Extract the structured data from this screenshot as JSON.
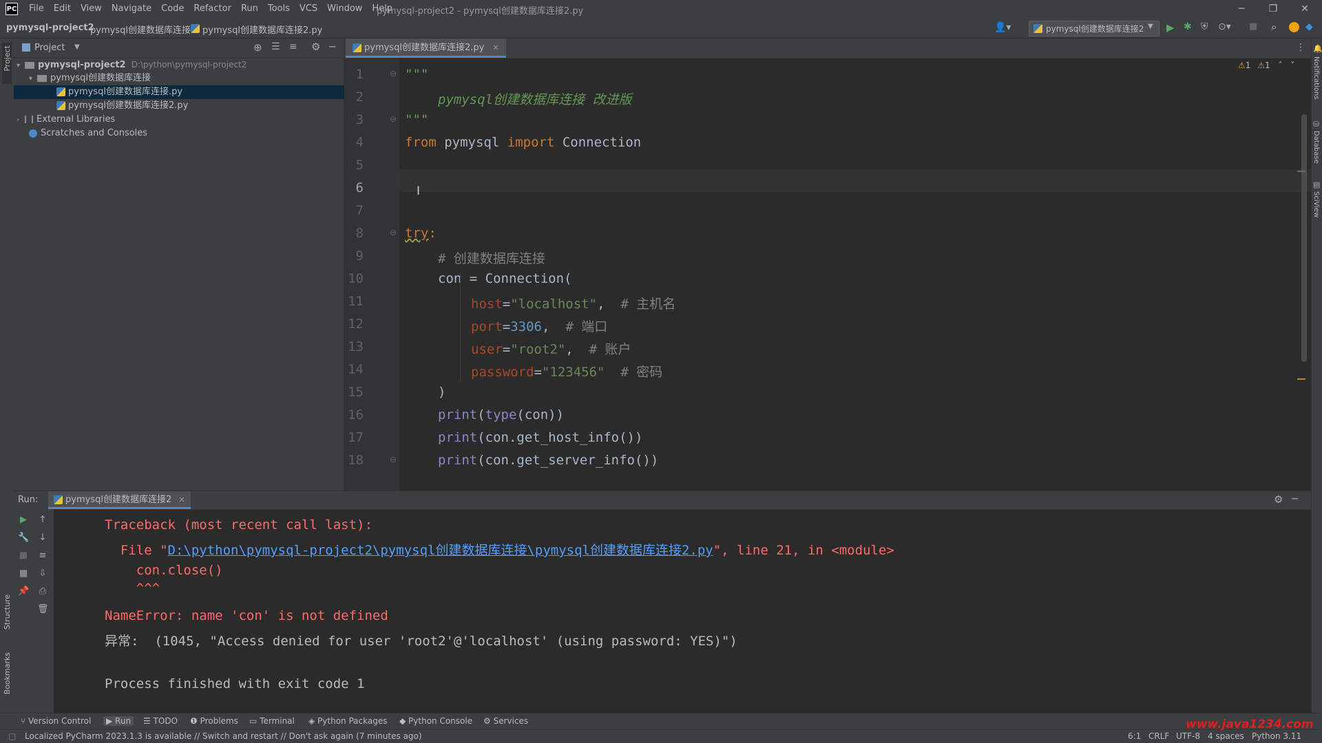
{
  "window": {
    "logo": "PC",
    "title": "pymysql-project2 - pymysql创建数据库连接2.py",
    "menu": [
      "File",
      "Edit",
      "View",
      "Navigate",
      "Code",
      "Refactor",
      "Run",
      "Tools",
      "VCS",
      "Window",
      "Help"
    ]
  },
  "breadcrumb": {
    "project": "pymysql-project2",
    "folder": "pymysql创建数据库连接",
    "file": "pymysql创建数据库连接2.py"
  },
  "toolbar": {
    "run_config": "pymysql创建数据库连接2"
  },
  "left_strip": {
    "project": "Project",
    "structure": "Structure",
    "bookmarks": "Bookmarks"
  },
  "right_strip": {
    "notifications": "Notifications",
    "database": "Database",
    "sciview": "SciView"
  },
  "project_panel": {
    "title": "Project",
    "tree": {
      "root_name": "pymysql-project2",
      "root_path": "D:\\python\\pymysql-project2",
      "folder": "pymysql创建数据库连接",
      "file1": "pymysql创建数据库连接.py",
      "file2": "pymysql创建数据库连接2.py",
      "external": "External Libraries",
      "scratches": "Scratches and Consoles"
    }
  },
  "editor": {
    "tab_label": "pymysql创建数据库连接2.py",
    "inspection": {
      "warnings": "1",
      "weak_warnings": "1"
    },
    "line_numbers": [
      "1",
      "2",
      "3",
      "4",
      "5",
      "6",
      "7",
      "8",
      "9",
      "10",
      "11",
      "12",
      "13",
      "14",
      "15",
      "16",
      "17",
      "18"
    ],
    "current_line": "6",
    "code": {
      "l1": "\"\"\"",
      "l2": "pymysql创建数据库连接 改进版",
      "l3": "\"\"\"",
      "l4_from": "from",
      "l4_mod": "pymysql",
      "l4_import": "import",
      "l4_name": "Connection",
      "l8_try": "try",
      "l8_colon": ":",
      "l9_comment": "# 创建数据库连接",
      "l10": "con = Connection(",
      "l11_param": "host",
      "l11_val": "\"localhost\"",
      "l11_cmt": "# 主机名",
      "l12_param": "port",
      "l12_val": "3306",
      "l12_cmt": "# 端口",
      "l13_param": "user",
      "l13_val": "\"root2\"",
      "l13_cmt": "# 账户",
      "l14_param": "password",
      "l14_val": "\"123456\"",
      "l14_cmt": "# 密码",
      "l15": ")",
      "l16_fn": "print",
      "l16_inner_fn": "type",
      "l16_rest": "(con))",
      "l17_fn": "print",
      "l17_rest": "(con.get_host_info())",
      "l18_fn": "print",
      "l18_rest": "(con.get_server_info())"
    }
  },
  "run_panel": {
    "label": "Run:",
    "tab_label": "pymysql创建数据库连接2",
    "output": {
      "traceback": "Traceback (most recent call last):",
      "file_prefix": "  File \"",
      "file_link": "D:\\python\\pymysql-project2\\pymysql创建数据库连接\\pymysql创建数据库连接2.py",
      "file_suffix": "\", line 21, in <module>",
      "code_line": "    con.close()",
      "caret": "    ^^^",
      "error": "NameError: name 'con' is not defined",
      "exception": "异常:  (1045, \"Access denied for user 'root2'@'localhost' (using password: YES)\")",
      "exit": "Process finished with exit code 1"
    }
  },
  "bottom_tools": [
    "Version Control",
    "Run",
    "TODO",
    "Problems",
    "Terminal",
    "Python Packages",
    "Python Console",
    "Services"
  ],
  "status_bar": {
    "message": "Localized PyCharm 2023.1.3 is available // Switch and restart // Don't ask again (7 minutes ago)",
    "position": "6:1",
    "line_sep": "CRLF",
    "encoding": "UTF-8",
    "indent": "4 spaces",
    "interpreter": "Python 3.11",
    "watermark": "www.java1234.com"
  }
}
